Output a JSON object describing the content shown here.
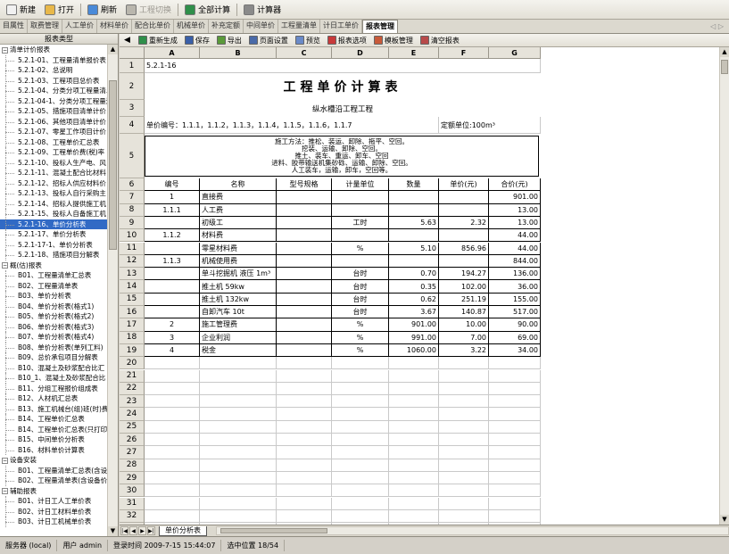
{
  "toolbar": [
    {
      "label": "新建",
      "icon": "new-icon",
      "color": "#f1f1f1",
      "disabled": false
    },
    {
      "label": "打开",
      "icon": "open-folder-icon",
      "color": "#e8b84a",
      "disabled": false
    },
    {
      "label": "刷新",
      "icon": "refresh-icon",
      "color": "#4a8ad8",
      "disabled": false
    },
    {
      "label": "工程切换",
      "icon": "switch-icon",
      "color": "#b9b6ad",
      "disabled": true
    },
    {
      "label": "全部计算",
      "icon": "calculate-all-icon",
      "color": "#2f8f4a",
      "disabled": false
    },
    {
      "label": "计算器",
      "icon": "calculator-icon",
      "color": "#8a8a8a",
      "disabled": false
    }
  ],
  "tabs": [
    "目属性",
    "取费管理",
    "人工单价",
    "材料单价",
    "配合比单价",
    "机械单价",
    "补充定额",
    "中间单价",
    "工程量清单",
    "计日工单价",
    "报表管理"
  ],
  "active_tab": "报表管理",
  "tabs_control": "◁ ▷",
  "sidebar": {
    "header": "报表类型",
    "nodes": [
      {
        "type": "group",
        "label": "清单计价报表",
        "expanded": true
      },
      {
        "type": "leaf",
        "label": "5.2.1-01、工程量清单报价表"
      },
      {
        "type": "leaf",
        "label": "5.2.1-02、总说明"
      },
      {
        "type": "leaf",
        "label": "5.2.1-03、工程项目总价表"
      },
      {
        "type": "leaf",
        "label": "5.2.1-04、分类分项工程量清单"
      },
      {
        "type": "leaf",
        "label": "5.2.1-04-1、分类分项工程量清单"
      },
      {
        "type": "leaf",
        "label": "5.2.1-05、措施项目清单计价"
      },
      {
        "type": "leaf",
        "label": "5.2.1-06、其他项目清单计价"
      },
      {
        "type": "leaf",
        "label": "5.2.1-07、零星工作项目计价"
      },
      {
        "type": "leaf",
        "label": "5.2.1-08、工程单价汇总表"
      },
      {
        "type": "leaf",
        "label": "5.2.1-09、工程单价费(税)率"
      },
      {
        "type": "leaf",
        "label": "5.2.1-10、投标人生产电、风"
      },
      {
        "type": "leaf",
        "label": "5.2.1-11、混凝土配合比材料"
      },
      {
        "type": "leaf",
        "label": "5.2.1-12、招标人供应材料价"
      },
      {
        "type": "leaf",
        "label": "5.2.1-13、投标人自行采购主"
      },
      {
        "type": "leaf",
        "label": "5.2.1-14、招标人提供施工机"
      },
      {
        "type": "leaf",
        "label": "5.2.1-15、投标人自备施工机"
      },
      {
        "type": "leaf",
        "label": "5.2.1-16、单价分析表",
        "selected": true
      },
      {
        "type": "leaf",
        "label": "5.2.1-17、单价分析表"
      },
      {
        "type": "leaf",
        "label": "5.2.1-17-1、单价分析表"
      },
      {
        "type": "leaf",
        "label": "5.2.1-18、措施项目分解表"
      },
      {
        "type": "group",
        "label": "概(估)报表",
        "expanded": true
      },
      {
        "type": "leaf",
        "label": "B01、工程量清单汇总表"
      },
      {
        "type": "leaf",
        "label": "B02、工程量清单表"
      },
      {
        "type": "leaf",
        "label": "B03、单价分析表"
      },
      {
        "type": "leaf",
        "label": "B04、单价分析表(格式1)"
      },
      {
        "type": "leaf",
        "label": "B05、单价分析表(格式2)"
      },
      {
        "type": "leaf",
        "label": "B06、单价分析表(格式3)"
      },
      {
        "type": "leaf",
        "label": "B07、单价分析表(格式4)"
      },
      {
        "type": "leaf",
        "label": "B08、单价分析表(单列工料)"
      },
      {
        "type": "leaf",
        "label": "B09、总价承包项目分解表"
      },
      {
        "type": "leaf",
        "label": "B10、混凝土及砂浆配合比汇"
      },
      {
        "type": "leaf",
        "label": "B10_1、混凝土及砂浆配合比"
      },
      {
        "type": "leaf",
        "label": "B11、分组工程报价组成表"
      },
      {
        "type": "leaf",
        "label": "B12、人材机汇总表"
      },
      {
        "type": "leaf",
        "label": "B13、施工机械台(组)班(时)费"
      },
      {
        "type": "leaf",
        "label": "B14、工程单价汇总表"
      },
      {
        "type": "leaf",
        "label": "B14、工程单价汇总表(只打印)"
      },
      {
        "type": "leaf",
        "label": "B15、中间单价分析表"
      },
      {
        "type": "leaf",
        "label": "B16、材料单价计算表"
      },
      {
        "type": "group",
        "label": "设备安装",
        "expanded": true
      },
      {
        "type": "leaf",
        "label": "B01、工程量清单汇总表(含设"
      },
      {
        "type": "leaf",
        "label": "B02、工程量清单表(含设备价"
      },
      {
        "type": "group",
        "label": "辅助报表",
        "expanded": true
      },
      {
        "type": "leaf",
        "label": "B01、计日工人工单价表"
      },
      {
        "type": "leaf",
        "label": "B02、计日工材料单价表"
      },
      {
        "type": "leaf",
        "label": "B03、计日工机械单价表"
      }
    ]
  },
  "report_toolbar": [
    {
      "label": "重新生成",
      "icon": "regenerate-icon",
      "color": "#2f8f4a"
    },
    {
      "label": "保存",
      "icon": "save-icon",
      "color": "#3a5fa8"
    },
    {
      "label": "导出",
      "icon": "export-icon",
      "color": "#5a9a3a"
    },
    {
      "label": "页面设置",
      "icon": "page-setup-icon",
      "color": "#4a6aa8"
    },
    {
      "label": "预览",
      "icon": "preview-icon",
      "color": "#6a8ac8"
    },
    {
      "label": "报表选项",
      "icon": "report-options-icon",
      "color": "#c83a3a"
    },
    {
      "label": "模板管理",
      "icon": "template-manage-icon",
      "color": "#c85a3a"
    },
    {
      "label": "清空报表",
      "icon": "clear-report-icon",
      "color": "#b84a4a"
    }
  ],
  "sheet": {
    "columns": [
      "A",
      "B",
      "C",
      "D",
      "E",
      "F",
      "G"
    ],
    "code": "5.2.1-16",
    "title": "工程单价计算表",
    "subtitle": "纵水槽沿工程工程",
    "unit_no_label": "单价编号：1.1.1，1.1.2，1.1.3，1.1.4，1.1.5，1.1.6，1.1.7",
    "quota_unit": "定额单位:100m³",
    "description_lines": [
      "施工方法：推松、装运、卸除、拖平、空回。",
      "挖装、运输、卸除、空回。",
      "推土、装车、重运、卸车、空回",
      "进料、胶带输送机集砂砾、运输、卸除、空回。",
      "人工装车，运输，卸车，空回等。"
    ],
    "headers": [
      "编号",
      "名称",
      "型号规格",
      "计量单位",
      "数量",
      "单价(元)",
      "合价(元)"
    ],
    "rows": [
      [
        "1",
        "直接费",
        "",
        "",
        "",
        "",
        "901.00"
      ],
      [
        "1.1.1",
        "人工费",
        "",
        "",
        "",
        "",
        "13.00"
      ],
      [
        "",
        "初级工",
        "",
        "工时",
        "5.63",
        "2.32",
        "13.00"
      ],
      [
        "1.1.2",
        "材料费",
        "",
        "",
        "",
        "",
        "44.00"
      ],
      [
        "",
        "零星材料费",
        "",
        "%",
        "5.10",
        "856.96",
        "44.00"
      ],
      [
        "1.1.3",
        "机械使用费",
        "",
        "",
        "",
        "",
        "844.00"
      ],
      [
        "",
        "单斗挖掘机 液压 1m³",
        "",
        "台时",
        "0.70",
        "194.27",
        "136.00"
      ],
      [
        "",
        "推土机 59kw",
        "",
        "台时",
        "0.35",
        "102.00",
        "36.00"
      ],
      [
        "",
        "推土机 132kw",
        "",
        "台时",
        "0.62",
        "251.19",
        "155.00"
      ],
      [
        "",
        "自卸汽车 10t",
        "",
        "台时",
        "3.67",
        "140.87",
        "517.00"
      ],
      [
        "2",
        "施工管理费",
        "",
        "%",
        "901.00",
        "10.00",
        "90.00"
      ],
      [
        "3",
        "企业利润",
        "",
        "%",
        "991.00",
        "7.00",
        "69.00"
      ],
      [
        "4",
        "税金",
        "",
        "%",
        "1060.00",
        "3.22",
        "34.00"
      ]
    ],
    "row_numbers": [
      "1",
      "2",
      "3",
      "4",
      "5",
      "6",
      "7",
      "8",
      "9",
      "10",
      "11",
      "12",
      "13",
      "14",
      "15",
      "16",
      "17",
      "18",
      "19",
      "20",
      "21",
      "22",
      "23",
      "24",
      "25",
      "26",
      "27",
      "28",
      "29",
      "30",
      "31",
      "32",
      "33",
      "34",
      "35"
    ]
  },
  "sheet_tab": "单价分析表",
  "sheet_nav": [
    "|◀",
    "◀",
    "▶",
    "▶|"
  ],
  "status": {
    "server": "服务器 (local)",
    "user": "用户 admin",
    "login": "登录时间 2009-7-15 15:44:07",
    "selection": "选中位置 18/54"
  }
}
